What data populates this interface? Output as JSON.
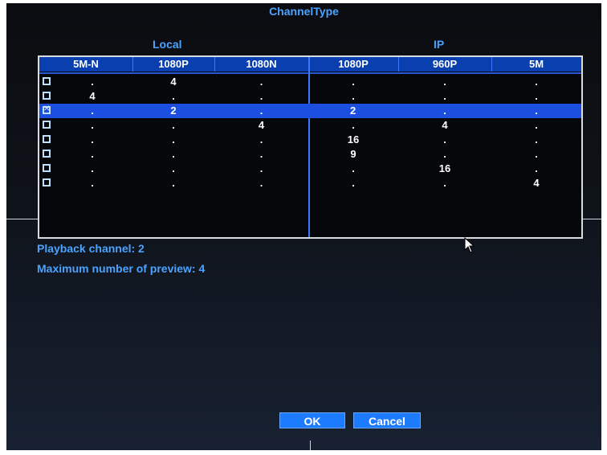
{
  "title": "ChannelType",
  "groups": {
    "local": "Local",
    "ip": "IP"
  },
  "columns": [
    "5M-N",
    "1080P",
    "1080N",
    "1080P",
    "960P",
    "5M"
  ],
  "rows": [
    {
      "checked": false,
      "selected": false,
      "cells": [
        ".",
        "4",
        ".",
        ".",
        ".",
        "."
      ]
    },
    {
      "checked": false,
      "selected": false,
      "cells": [
        "4",
        ".",
        ".",
        ".",
        ".",
        "."
      ]
    },
    {
      "checked": true,
      "selected": true,
      "cells": [
        ".",
        "2",
        ".",
        "2",
        ".",
        "."
      ]
    },
    {
      "checked": false,
      "selected": false,
      "cells": [
        ".",
        ".",
        "4",
        ".",
        "4",
        "."
      ]
    },
    {
      "checked": false,
      "selected": false,
      "cells": [
        ".",
        ".",
        ".",
        "16",
        ".",
        "."
      ]
    },
    {
      "checked": false,
      "selected": false,
      "cells": [
        ".",
        ".",
        ".",
        "9",
        ".",
        "."
      ]
    },
    {
      "checked": false,
      "selected": false,
      "cells": [
        ".",
        ".",
        ".",
        ".",
        "16",
        "."
      ]
    },
    {
      "checked": false,
      "selected": false,
      "cells": [
        ".",
        ".",
        ".",
        ".",
        ".",
        "4"
      ]
    }
  ],
  "info": {
    "playback": "Playback channel: 2",
    "preview": "Maximum number of preview: 4"
  },
  "buttons": {
    "ok": "OK",
    "cancel": "Cancel"
  },
  "colors": {
    "accent": "#4aa3ff",
    "header": "#0a3fb0",
    "selected_row": "#1c4fe0",
    "button": "#1d7bff"
  },
  "icons": {
    "cursor": "mouse-pointer-icon"
  }
}
